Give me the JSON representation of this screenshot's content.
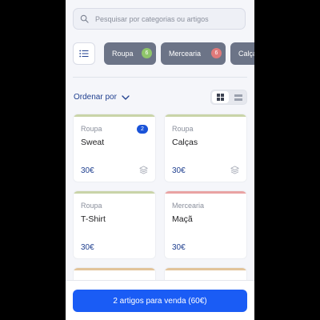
{
  "search": {
    "placeholder": "Pesquisar por categorias ou artigos"
  },
  "filters": {
    "chips": [
      {
        "label": "Roupa",
        "count": "6",
        "badge_color": "#8fc56a"
      },
      {
        "label": "Mercearia",
        "count": "6",
        "badge_color": "#e07a7a"
      },
      {
        "label": "Calça",
        "count": "",
        "badge_color": ""
      }
    ]
  },
  "sort": {
    "label": "Ordenar por"
  },
  "products": [
    {
      "category": "Roupa",
      "name": "Sweat",
      "price": "30€",
      "badge": "2",
      "accent": "#c9d4a8"
    },
    {
      "category": "Roupa",
      "name": "Calças",
      "price": "30€",
      "badge": "",
      "accent": "#c9d4a8"
    },
    {
      "category": "Roupa",
      "name": "T-Shirt",
      "price": "30€",
      "badge": "",
      "accent": "#c9d4a8"
    },
    {
      "category": "Mercearia",
      "name": "Maçã",
      "price": "30€",
      "badge": "",
      "accent": "#e9a3a3"
    }
  ],
  "footer": {
    "cta_label": "2 artigos para venda (60€)"
  },
  "colors": {
    "accent": "#1a5cf5",
    "chip": "#6c7487",
    "link": "#1f3f8f"
  }
}
